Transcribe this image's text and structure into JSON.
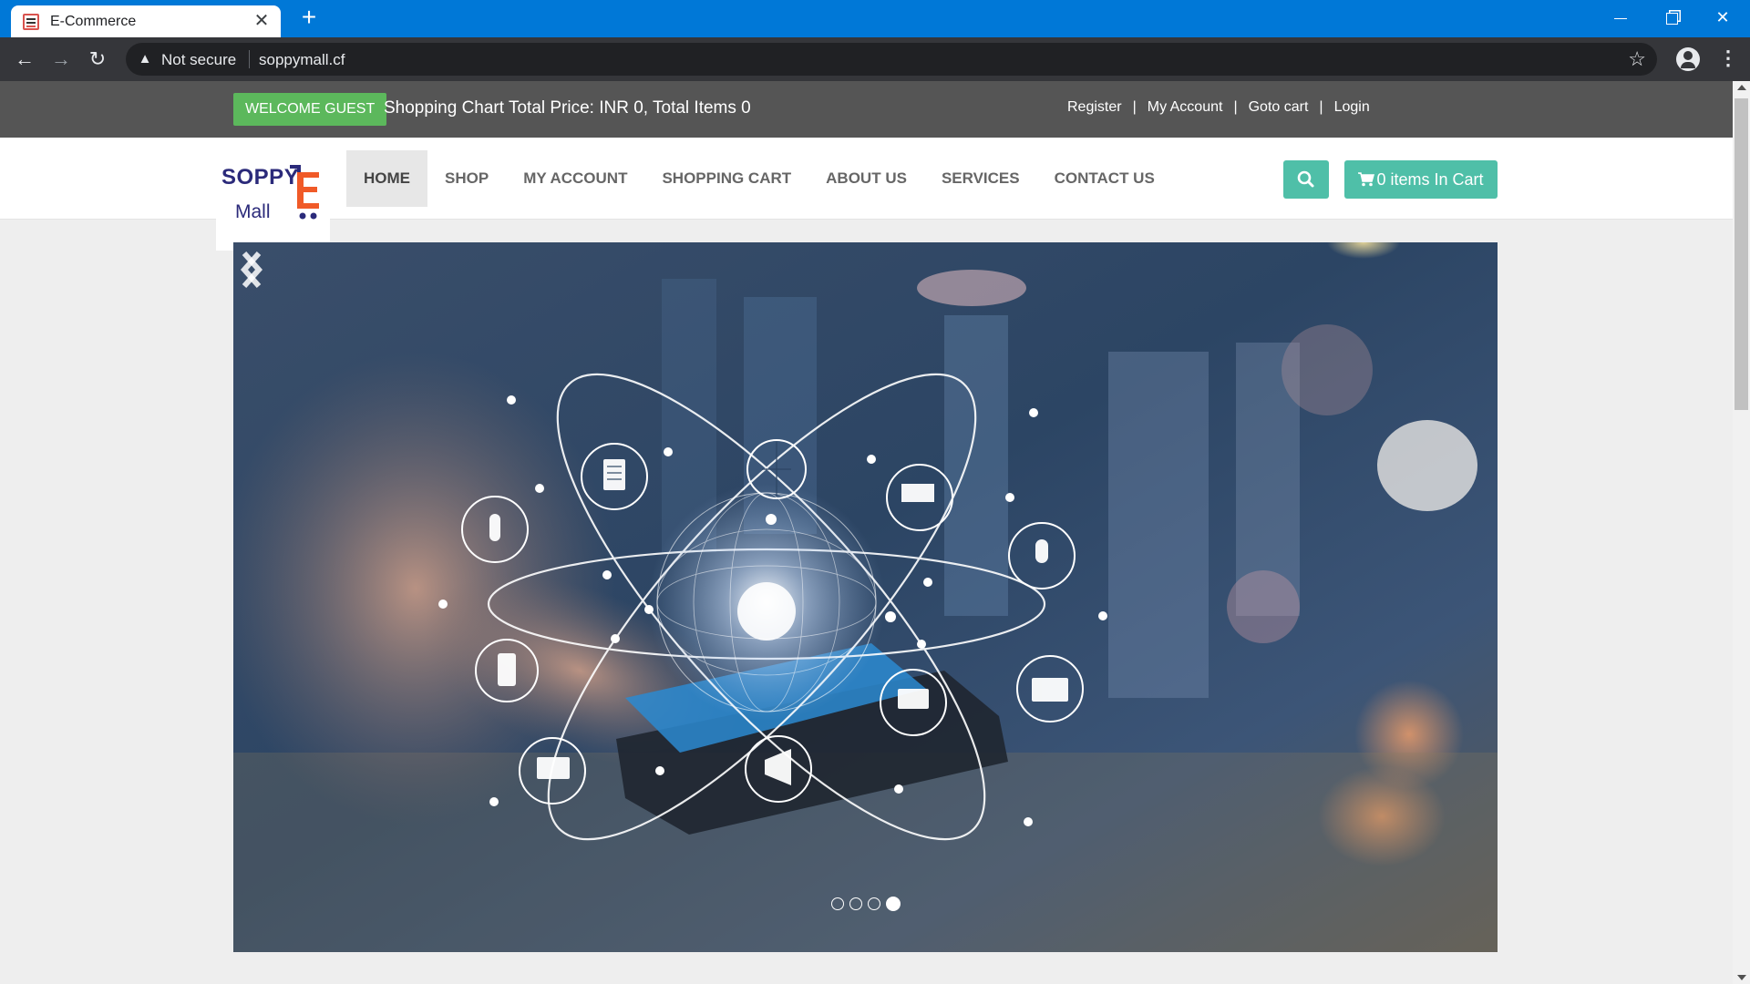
{
  "browser": {
    "tab_title": "E-Commerce",
    "security_label": "Not secure",
    "url": "soppymall.cf",
    "icons": [
      "favicon",
      "close-icon",
      "plus-icon",
      "back-icon",
      "forward-icon",
      "reload-icon",
      "warning-icon",
      "star-icon",
      "profile-icon",
      "menu-icon"
    ]
  },
  "topbar": {
    "welcome": "WELCOME GUEST",
    "cart_summary": "Shopping Chart Total Price: INR 0, Total Items 0",
    "links": [
      "Register",
      "My Account",
      "Goto cart",
      "Login"
    ],
    "separator": "|"
  },
  "logo": {
    "line1": "SOPPY",
    "line2": "Mall"
  },
  "nav": {
    "items": [
      "HOME",
      "SHOP",
      "MY ACCOUNT",
      "SHOPPING CART",
      "ABOUT US",
      "SERVICES",
      "CONTACT US"
    ],
    "active": "HOME",
    "cart_button": "0 items In Cart"
  },
  "colors": {
    "topbar": "#555555",
    "welcome_badge": "#5cb85c",
    "accent_buttons": "#4fbfa8",
    "browser_titlebar": "#0078d7",
    "logo_text": "#2b2a7a",
    "logo_e": "#f05a28"
  },
  "carousel": {
    "slide_count": 4,
    "active_slide": 4,
    "image_subject": "hand holding smartphone with network globe and icons"
  }
}
